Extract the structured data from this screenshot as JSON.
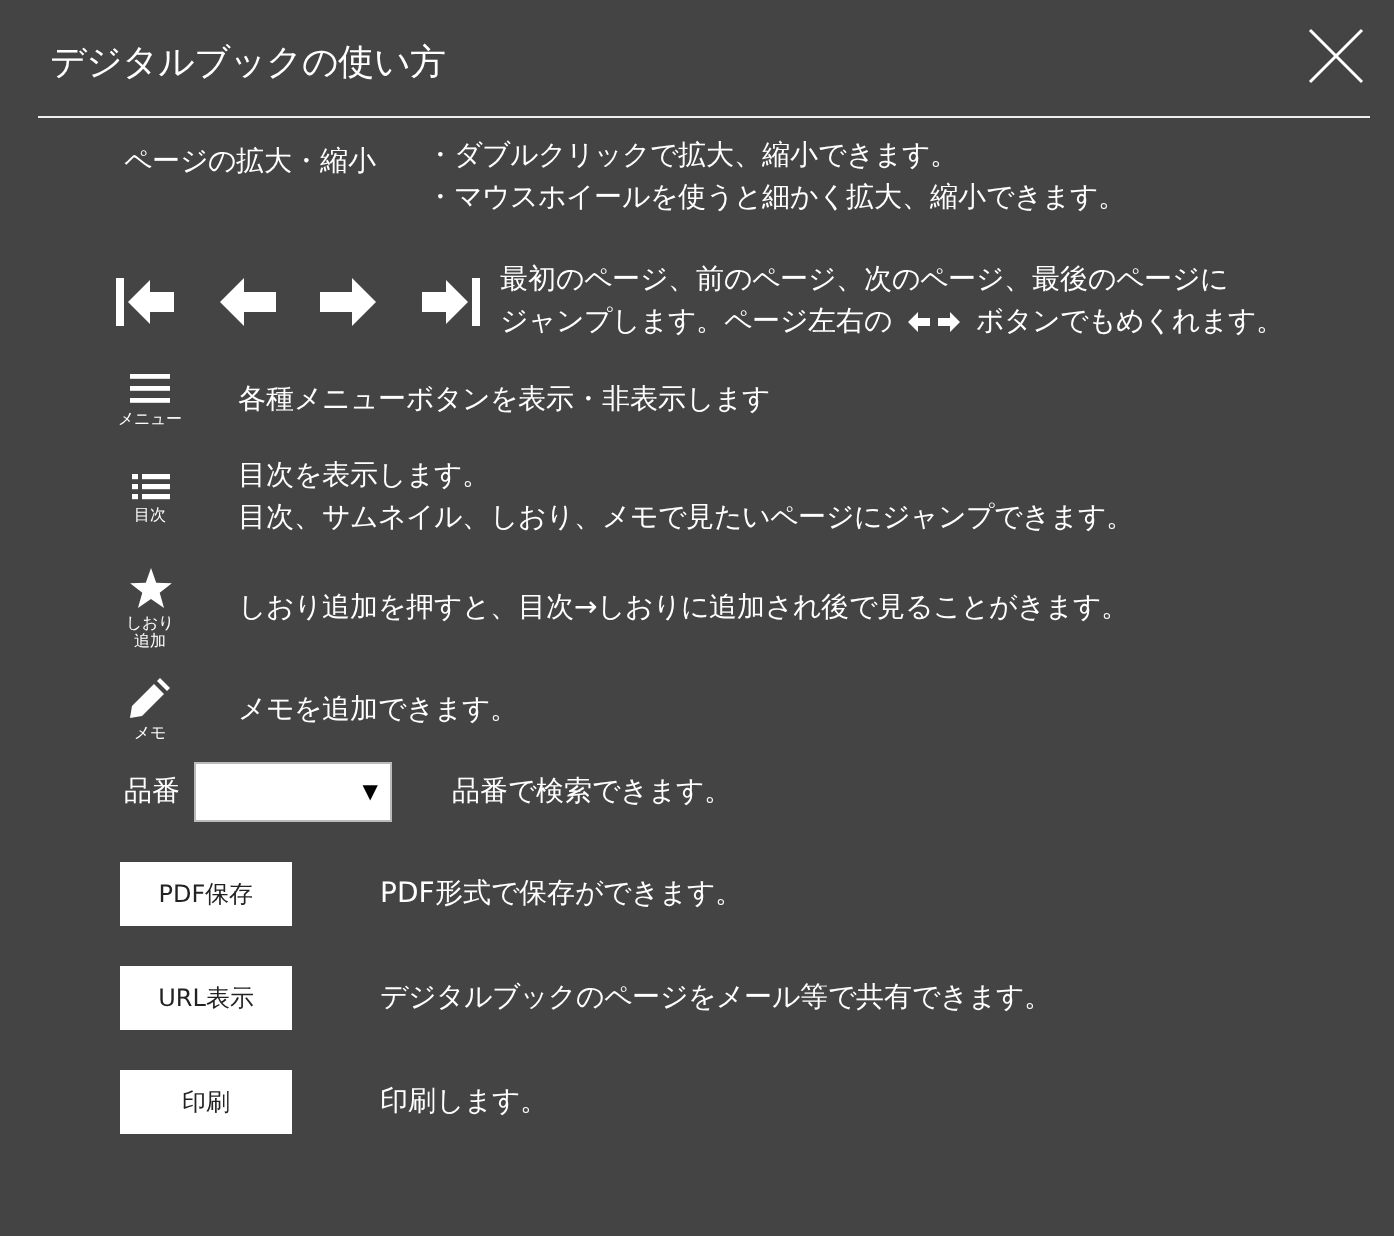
{
  "window": {
    "title": "デジタルブックの使い方"
  },
  "rows": [
    {
      "kind": "zoom",
      "label": "ページの拡大・縮小",
      "lines": [
        "・ダブルクリックで拡大、縮小できます。",
        "・マウスホイールを使うと細かく拡大、縮小できます。"
      ]
    },
    {
      "kind": "nav",
      "line1": "最初のページ、前のページ、次のページ、最後のページに",
      "line2_before": "ジャンプします。ページ左右の",
      "line2_after": "ボタンでもめくれます。"
    },
    {
      "kind": "menu",
      "caption": "メニュー",
      "lines": [
        "各種メニューボタンを表示・非表示します"
      ]
    },
    {
      "kind": "toc",
      "caption": "目次",
      "lines": [
        "目次を表示します。",
        "目次、サムネイル、しおり、メモで見たいページにジャンプできます。"
      ]
    },
    {
      "kind": "bookmark",
      "caption": "しおり追加",
      "lines": [
        "しおり追加を押すと、目次→しおりに追加され後で見ることがきます。"
      ]
    },
    {
      "kind": "memo",
      "caption": "メモ",
      "lines": [
        "メモを追加できます。"
      ]
    },
    {
      "kind": "select",
      "label": "品番",
      "arrow": "▼",
      "text": "品番で検索できます。"
    },
    {
      "kind": "button",
      "button": "PDF保存",
      "text": "PDF形式で保存ができます。"
    },
    {
      "kind": "button",
      "button": "URL表示",
      "text": "デジタルブックのページをメール等で共有できます。"
    },
    {
      "kind": "button",
      "button": "印刷",
      "text": "印刷します。"
    }
  ]
}
